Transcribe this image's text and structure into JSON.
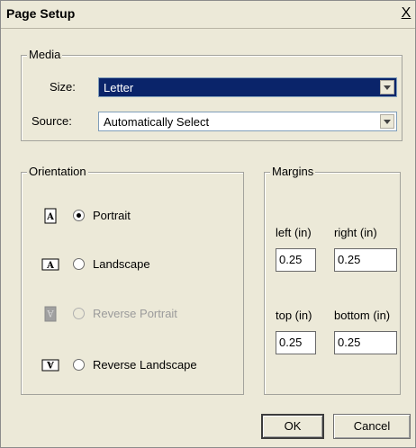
{
  "dialog": {
    "title": "Page Setup",
    "close_label": "X"
  },
  "media": {
    "legend": "Media",
    "size_label": "Size:",
    "size_value": "Letter",
    "source_label": "Source:",
    "source_value": "Automatically Select"
  },
  "orientation": {
    "legend": "Orientation",
    "options": [
      {
        "label": "Portrait",
        "selected": true,
        "enabled": true,
        "icon": "portrait-icon"
      },
      {
        "label": "Landscape",
        "selected": false,
        "enabled": true,
        "icon": "landscape-icon"
      },
      {
        "label": "Reverse Portrait",
        "selected": false,
        "enabled": false,
        "icon": "reverse-portrait-icon"
      },
      {
        "label": "Reverse Landscape",
        "selected": false,
        "enabled": true,
        "icon": "reverse-landscape-icon"
      }
    ]
  },
  "margins": {
    "legend": "Margins",
    "left_label": "left (in)",
    "left_value": "0.25",
    "right_label": "right (in)",
    "right_value": "0.25",
    "top_label": "top (in)",
    "top_value": "0.25",
    "bottom_label": "bottom (in)",
    "bottom_value": "0.25"
  },
  "buttons": {
    "ok_label": "OK",
    "cancel_label": "Cancel"
  }
}
